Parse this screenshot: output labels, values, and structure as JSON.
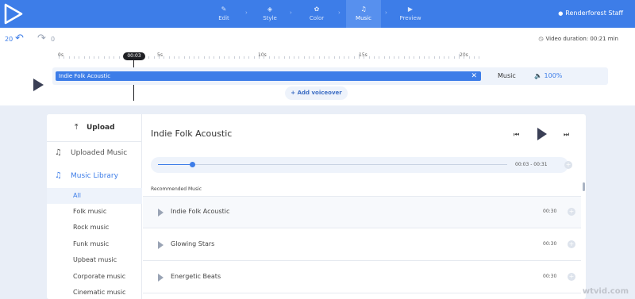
{
  "topbar": {
    "steps": [
      {
        "icon": "✎",
        "label": "Edit"
      },
      {
        "icon": "◈",
        "label": "Style"
      },
      {
        "icon": "✿",
        "label": "Color"
      },
      {
        "icon": "♫",
        "label": "Music"
      },
      {
        "icon": "▶",
        "label": "Preview"
      }
    ],
    "active_step": "Music",
    "user_name": "Renderforest Staff"
  },
  "history": {
    "undo_count": "20",
    "redo_count": "0"
  },
  "duration": "Video duration: 00:21 min",
  "timeline": {
    "playhead_time": "00:03",
    "ruler_labels": [
      "0s",
      "5s",
      "10s",
      "15s",
      "20s"
    ],
    "clip_name": "Indie Folk Acoustic",
    "track_label": "Music",
    "volume": "100%",
    "add_voiceover": "Add voiceover"
  },
  "sidebar": {
    "upload": "Upload",
    "uploaded_music": "Uploaded Music",
    "music_library": "Music Library",
    "categories": [
      "All",
      "Folk music",
      "Rock music",
      "Funk music",
      "Upbeat music",
      "Corporate music",
      "Cinematic music"
    ],
    "active_category": "All"
  },
  "player": {
    "title": "Indie Folk Acoustic",
    "progress_fraction": 0.097,
    "time": "00:03 - 00:31"
  },
  "recommended": {
    "heading": "Recommended Music",
    "tracks": [
      {
        "name": "Indie Folk Acoustic",
        "duration": "00:30"
      },
      {
        "name": "Glowing Stars",
        "duration": "00:30"
      },
      {
        "name": "Energetic Beats",
        "duration": "00:30"
      }
    ]
  },
  "colors": {
    "accent": "#3d7de8",
    "background": "#e9eef7"
  },
  "watermark": "wtvid.com"
}
